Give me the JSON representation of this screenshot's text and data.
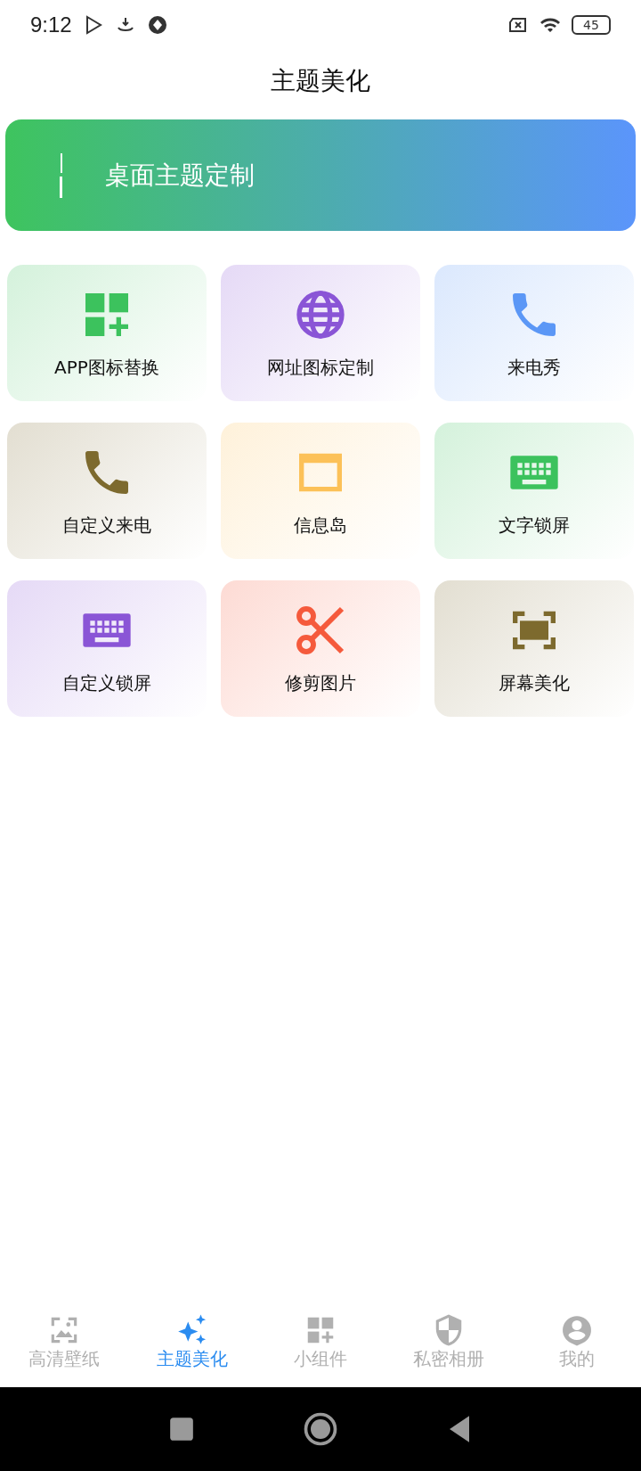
{
  "status_bar": {
    "time": "9:12",
    "battery": "45"
  },
  "header": {
    "title": "主题美化"
  },
  "banner": {
    "label": "桌面主题定制"
  },
  "tiles": [
    {
      "label": "APP图标替换",
      "kind": "apps",
      "color": "#3cc25d"
    },
    {
      "label": "网址图标定制",
      "kind": "globe",
      "color": "#8a55d6"
    },
    {
      "label": "来电秀",
      "kind": "phone",
      "color": "#5b97f6"
    },
    {
      "label": "自定义来电",
      "kind": "phone",
      "color": "#7d6a2e"
    },
    {
      "label": "信息岛",
      "kind": "window",
      "color": "#fcc158"
    },
    {
      "label": "文字锁屏",
      "kind": "keyboard",
      "color": "#3cc25d"
    },
    {
      "label": "自定义锁屏",
      "kind": "keyboard",
      "color": "#8a55d6"
    },
    {
      "label": "修剪图片",
      "kind": "scissors",
      "color": "#f55a3c"
    },
    {
      "label": "屏幕美化",
      "kind": "screen",
      "color": "#7d6a2e"
    }
  ],
  "nav": [
    {
      "label": "高清壁纸",
      "kind": "wallpaper",
      "selected": false
    },
    {
      "label": "主题美化",
      "kind": "sparkle",
      "selected": true
    },
    {
      "label": "小组件",
      "kind": "widgets",
      "selected": false
    },
    {
      "label": "私密相册",
      "kind": "shield",
      "selected": false
    },
    {
      "label": "我的",
      "kind": "person",
      "selected": false
    }
  ]
}
